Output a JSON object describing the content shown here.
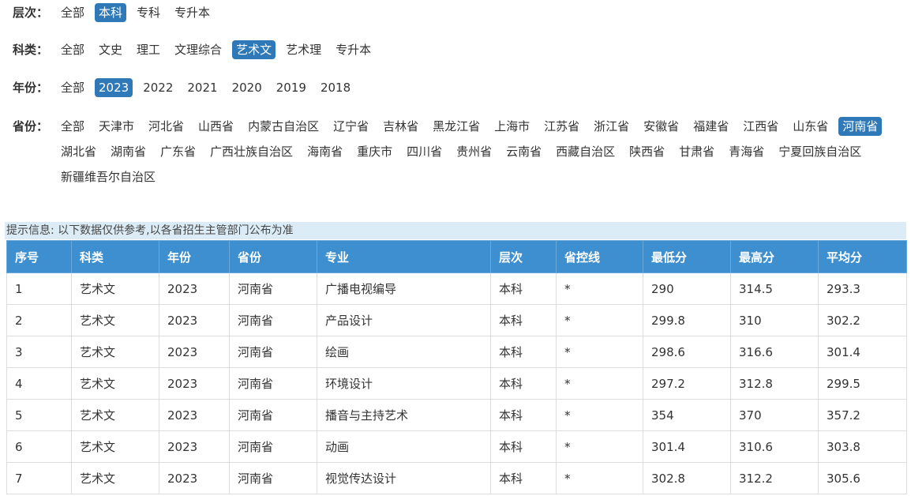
{
  "filters": {
    "level": {
      "label": "层次：",
      "options": [
        "全部",
        "本科",
        "专科",
        "专升本"
      ],
      "selected": "本科"
    },
    "subject": {
      "label": "科类：",
      "options": [
        "全部",
        "文史",
        "理工",
        "文理综合",
        "艺术文",
        "艺术理",
        "专升本"
      ],
      "selected": "艺术文"
    },
    "year": {
      "label": "年份：",
      "options": [
        "全部",
        "2023",
        "2022",
        "2021",
        "2020",
        "2019",
        "2018"
      ],
      "selected": "2023"
    },
    "province": {
      "label": "省份：",
      "options": [
        "全部",
        "天津市",
        "河北省",
        "山西省",
        "内蒙古自治区",
        "辽宁省",
        "吉林省",
        "黑龙江省",
        "上海市",
        "江苏省",
        "浙江省",
        "安徽省",
        "福建省",
        "江西省",
        "山东省",
        "河南省",
        "湖北省",
        "湖南省",
        "广东省",
        "广西壮族自治区",
        "海南省",
        "重庆市",
        "四川省",
        "贵州省",
        "云南省",
        "西藏自治区",
        "陕西省",
        "甘肃省",
        "青海省",
        "宁夏回族自治区",
        "新疆维吾尔自治区"
      ],
      "selected": "河南省"
    }
  },
  "notice": "提示信息: 以下数据仅供参考,以各省招生主管部门公布为准",
  "table": {
    "columns": [
      "序号",
      "科类",
      "年份",
      "省份",
      "专业",
      "层次",
      "省控线",
      "最低分",
      "最高分",
      "平均分"
    ],
    "rows": [
      [
        "1",
        "艺术文",
        "2023",
        "河南省",
        "广播电视编导",
        "本科",
        "*",
        "290",
        "314.5",
        "293.3"
      ],
      [
        "2",
        "艺术文",
        "2023",
        "河南省",
        "产品设计",
        "本科",
        "*",
        "299.8",
        "310",
        "302.2"
      ],
      [
        "3",
        "艺术文",
        "2023",
        "河南省",
        "绘画",
        "本科",
        "*",
        "298.6",
        "316.6",
        "301.4"
      ],
      [
        "4",
        "艺术文",
        "2023",
        "河南省",
        "环境设计",
        "本科",
        "*",
        "297.2",
        "312.8",
        "299.5"
      ],
      [
        "5",
        "艺术文",
        "2023",
        "河南省",
        "播音与主持艺术",
        "本科",
        "*",
        "354",
        "370",
        "357.2"
      ],
      [
        "6",
        "艺术文",
        "2023",
        "河南省",
        "动画",
        "本科",
        "*",
        "301.4",
        "310.6",
        "303.8"
      ],
      [
        "7",
        "艺术文",
        "2023",
        "河南省",
        "视觉传达设计",
        "本科",
        "*",
        "302.8",
        "312.2",
        "305.6"
      ]
    ]
  }
}
